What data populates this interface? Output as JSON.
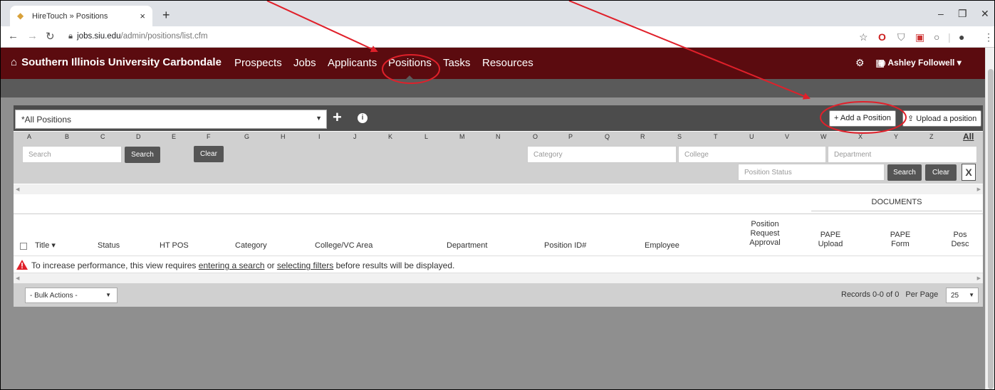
{
  "browser": {
    "tab_title": "HireTouch » Positions",
    "tab_close": "×",
    "new_tab": "+",
    "url_domain": "jobs.siu.edu",
    "url_path": "/admin/positions/list.cfm",
    "window_controls": [
      "–",
      "❐",
      "✕"
    ]
  },
  "header": {
    "brand": "Southern Illinois University Carbondale",
    "nav": [
      "Prospects",
      "Jobs",
      "Applicants",
      "Positions",
      "Tasks",
      "Resources"
    ],
    "active_nav": "Positions",
    "user_name": "Ashley Followell",
    "colors": {
      "header_bg": "#5b0b0f",
      "annotation": "#e0202a"
    }
  },
  "toolbar": {
    "filter_select": "*All Positions",
    "add_position": "+ Add a Position",
    "upload_position": "Upload a position"
  },
  "alphabet": [
    "A",
    "B",
    "C",
    "D",
    "E",
    "F",
    "G",
    "H",
    "I",
    "J",
    "K",
    "L",
    "M",
    "N",
    "O",
    "P",
    "Q",
    "R",
    "S",
    "T",
    "U",
    "V",
    "W",
    "X",
    "Y",
    "Z"
  ],
  "alphabet_all": "All",
  "filters": {
    "search_placeholder": "Search",
    "search_button": "Search",
    "clear_button": "Clear",
    "category_placeholder": "Category",
    "college_placeholder": "College",
    "department_placeholder": "Department",
    "position_status_placeholder": "Position Status",
    "search_button2": "Search",
    "clear_button2": "Clear",
    "excel_icon": "excel-export-icon"
  },
  "table": {
    "group_label": "DOCUMENTS",
    "headers": {
      "title": "Title ▾",
      "status": "Status",
      "ht_pos": "HT POS",
      "category": "Category",
      "college": "College/VC Area",
      "department": "Department",
      "position_id": "Position ID#",
      "employee": "Employee",
      "pra_1": "Position",
      "pra_2": "Request",
      "pra_3": "Approval",
      "pape_upload_1": "PAPE",
      "pape_upload_2": "Upload",
      "pape_form_1": "PAPE",
      "pape_form_2": "Form",
      "pos_desc_1": "Pos",
      "pos_desc_2": "Desc"
    },
    "warning": {
      "before": "To increase performance, this view requires ",
      "link1": "entering a search",
      "middle": " or ",
      "link2": "selecting filters",
      "after": " before results will be displayed."
    }
  },
  "footer": {
    "bulk_actions": "- Bulk Actions -",
    "records": "Records 0-0 of 0",
    "per_page_label": "Per Page",
    "per_page_value": "25"
  }
}
